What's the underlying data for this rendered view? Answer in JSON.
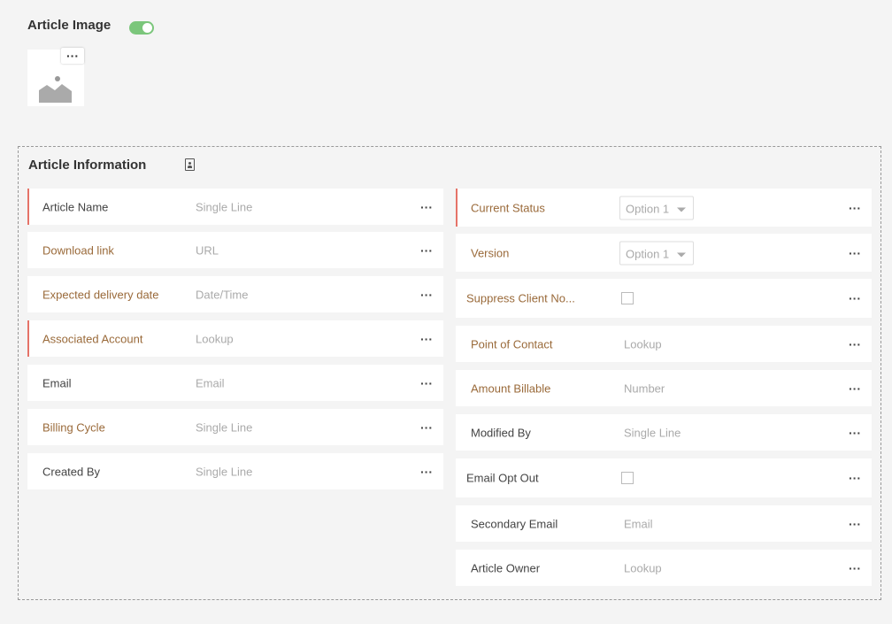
{
  "image_section": {
    "title": "Article Image",
    "toggle_on": true,
    "menu_label": "···"
  },
  "info_section": {
    "title": "Article Information"
  },
  "dots": "···",
  "left_fields": [
    {
      "label": "Article Name",
      "placeholder": "Single Line",
      "required": true,
      "color": "dark"
    },
    {
      "label": "Download link",
      "placeholder": "URL",
      "required": false,
      "color": "brown"
    },
    {
      "label": "Expected delivery date",
      "placeholder": "Date/Time",
      "required": false,
      "color": "brown"
    },
    {
      "label": "Associated Account",
      "placeholder": "Lookup",
      "required": true,
      "color": "brown"
    },
    {
      "label": "Email",
      "placeholder": "Email",
      "required": false,
      "color": "dark"
    },
    {
      "label": "Billing Cycle",
      "placeholder": "Single Line",
      "required": false,
      "color": "brown"
    },
    {
      "label": "Created By",
      "placeholder": "Single Line",
      "required": false,
      "color": "dark"
    }
  ],
  "right_fields": [
    {
      "label": "Current Status",
      "type": "select",
      "value": "Option 1",
      "required": true,
      "color": "brown"
    },
    {
      "label": "Version",
      "type": "select",
      "value": "Option 1",
      "required": false,
      "color": "brown"
    },
    {
      "label": "Suppress Client No...",
      "type": "checkbox",
      "required": false,
      "color": "brown"
    },
    {
      "label": "Point of Contact",
      "placeholder": "Lookup",
      "required": false,
      "color": "brown"
    },
    {
      "label": "Amount Billable",
      "placeholder": "Number",
      "required": false,
      "color": "brown"
    },
    {
      "label": "Modified By",
      "placeholder": "Single Line",
      "required": false,
      "color": "dark"
    },
    {
      "label": "Email Opt Out",
      "type": "checkbox",
      "required": false,
      "color": "dark"
    },
    {
      "label": "Secondary Email",
      "placeholder": "Email",
      "required": false,
      "color": "dark"
    },
    {
      "label": "Article Owner",
      "placeholder": "Lookup",
      "required": false,
      "color": "dark"
    }
  ],
  "colors": {
    "required_marker": "#e57368",
    "toggle_on": "#7bc67b",
    "brown_label": "#9a6a3a"
  }
}
